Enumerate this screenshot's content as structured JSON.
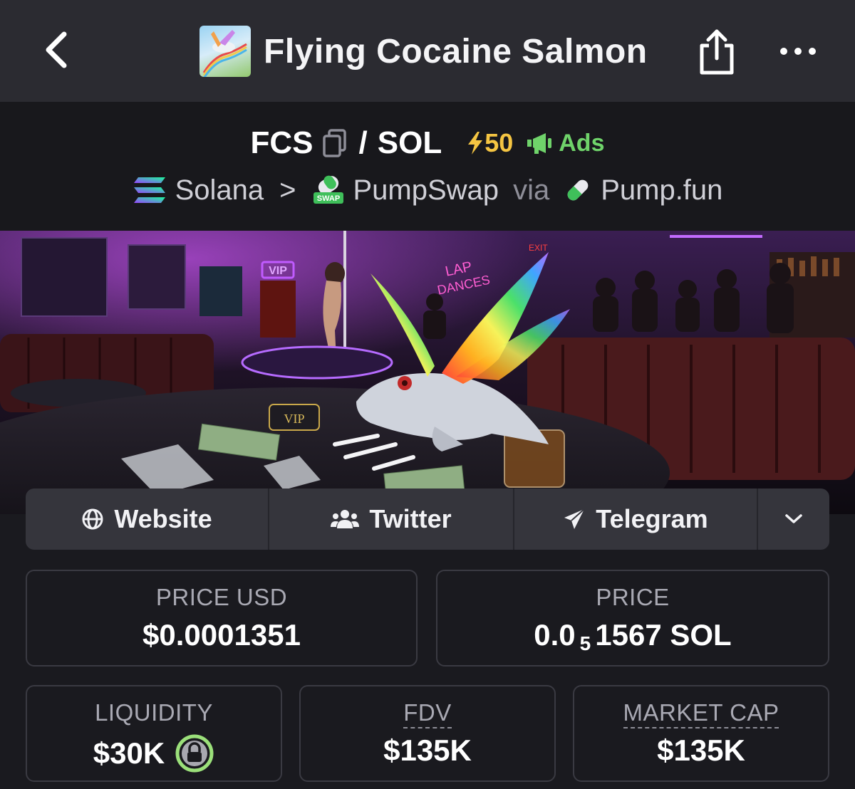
{
  "header": {
    "title": "Flying Cocaine Salmon"
  },
  "pair": {
    "base": "FCS",
    "slash": "/",
    "quote": "SOL",
    "boost": "50",
    "ads_label": "Ads"
  },
  "chain": {
    "network": "Solana",
    "separator": ">",
    "dex": "PumpSwap",
    "via": "via",
    "launchpad": "Pump.fun"
  },
  "banner": {
    "sign_vip": "VIP",
    "sign_lap": "LAP",
    "sign_dances": "DANCES",
    "sign_exit": "EXIT",
    "tray_vip": "VIP"
  },
  "links": {
    "website": "Website",
    "twitter": "Twitter",
    "telegram": "Telegram"
  },
  "stats": {
    "price_usd_label": "PRICE USD",
    "price_usd_value": "$0.0001351",
    "price_label": "PRICE",
    "price_prefix": "0.0",
    "price_zeros": "5",
    "price_digits": "1567 SOL",
    "liquidity_label": "LIQUIDITY",
    "liquidity_value": "$30K",
    "fdv_label": "FDV",
    "fdv_value": "$135K",
    "mcap_label": "MARKET CAP",
    "mcap_value": "$135K"
  },
  "colors": {
    "boost": "#f5c542",
    "ads": "#6fd36a",
    "lock": "#9be07a"
  }
}
